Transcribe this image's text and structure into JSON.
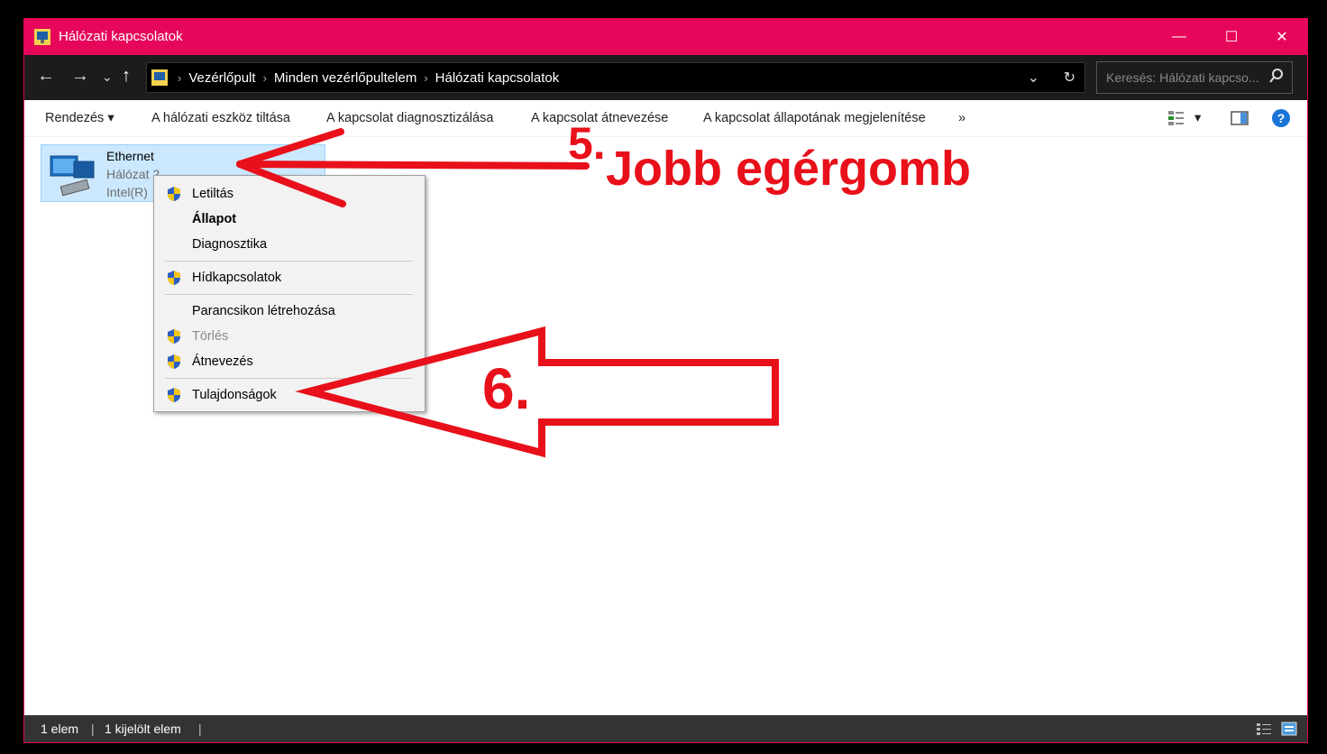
{
  "window": {
    "title": "Hálózati kapcsolatok",
    "accent": "#e6065a"
  },
  "titlebar": {
    "minimize": "—",
    "maximize": "☐",
    "close": "✕"
  },
  "nav": {
    "back": "←",
    "forward": "→",
    "recent": "⌄",
    "up": "↑"
  },
  "breadcrumb": {
    "items": [
      "Vezérlőpult",
      "Minden vezérlőpultelem",
      "Hálózati kapcsolatok"
    ],
    "sep": "›",
    "dropdown": "⌄",
    "refresh": "↻"
  },
  "search": {
    "placeholder": "Keresés: Hálózati kapcso..."
  },
  "commands": {
    "organize": "Rendezés ▾",
    "disable": "A hálózati eszköz tiltása",
    "diagnose": "A kapcsolat diagnosztizálása",
    "rename": "A kapcsolat átnevezése",
    "status": "A kapcsolat állapotának megjelenítése",
    "more": "»",
    "view": "▾"
  },
  "item": {
    "name": "Ethernet",
    "network": "Hálózat 2",
    "adapter": "Intel(R)"
  },
  "context_menu": {
    "items": [
      {
        "label": "Letiltás",
        "shield": true
      },
      {
        "label": "Állapot",
        "bold": true
      },
      {
        "label": "Diagnosztika"
      },
      {
        "label": "Hídkapcsolatok",
        "shield": true
      },
      {
        "label": "Parancsikon létrehozása"
      },
      {
        "label": "Törlés",
        "shield": true,
        "disabled": true
      },
      {
        "label": "Átnevezés",
        "shield": true
      },
      {
        "label": "Tulajdonságok",
        "shield": true
      }
    ]
  },
  "status": {
    "count": "1 elem",
    "selected": "1 kijelölt elem"
  },
  "annotations": {
    "step5_num": "5.",
    "step5_text": "Jobb egérgomb",
    "step6": "6.",
    "color": "#e8101a"
  }
}
